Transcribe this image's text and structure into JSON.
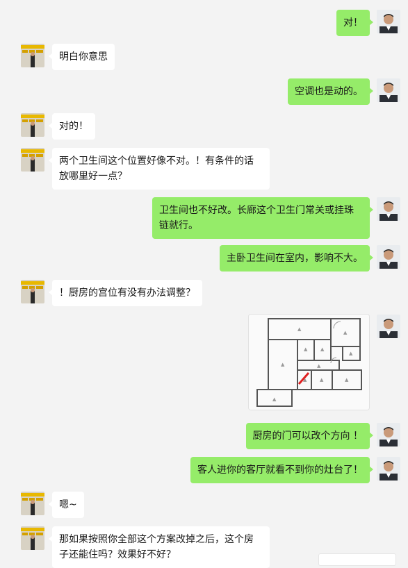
{
  "messages": [
    {
      "side": "self",
      "text": "对！"
    },
    {
      "side": "other",
      "text": "明白你意思"
    },
    {
      "side": "self",
      "text": "空调也是动的。"
    },
    {
      "side": "other",
      "text": "对的！"
    },
    {
      "side": "other",
      "text": "两个卫生间这个位置好像不对。！有条件的话放哪里好一点？"
    },
    {
      "side": "self",
      "text": "卫生间也不好改。长廊这个卫生门常关或挂珠链就行。"
    },
    {
      "side": "self",
      "text": "主卧卫生间在室内，影响不大。"
    },
    {
      "side": "other",
      "text": "！厨房的宫位有没有办法调整？"
    },
    {
      "side": "self",
      "type": "image",
      "image_label": "floor-plan"
    },
    {
      "side": "self",
      "text": "厨房的门可以改个方向 ！"
    },
    {
      "side": "self",
      "text": "客人进你的客厅就看不到你的灶台了！"
    },
    {
      "side": "other",
      "text": "嗯~"
    },
    {
      "side": "other",
      "text": "那如果按照你全部这个方案改掉之后，这个房子还能住吗？效果好不好？"
    }
  ],
  "colors": {
    "self_bubble": "#95ec69",
    "other_bubble": "#ffffff",
    "background": "#f3f3f3"
  },
  "avatars": {
    "self": "man-in-suit-avatar",
    "other": "yellow-sign-avatar"
  }
}
